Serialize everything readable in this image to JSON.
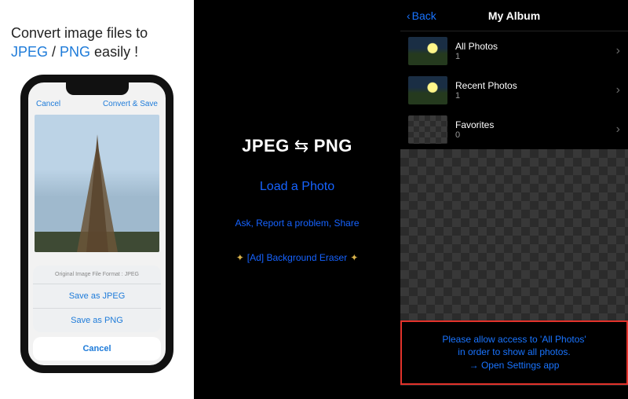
{
  "panel1": {
    "headline_pre": "Convert image files to ",
    "jpeg": "JPEG",
    "sep": " / ",
    "png": "PNG",
    "tail": " easily !",
    "phone": {
      "cancel": "Cancel",
      "convert": "Convert & Save",
      "sheet_header": "Original Image File Format : JPEG",
      "save_jpeg": "Save as JPEG",
      "save_png": "Save as PNG",
      "sheet_cancel": "Cancel"
    }
  },
  "panel2": {
    "title_l": "JPEG",
    "title_r": "PNG",
    "load": "Load a Photo",
    "ask": "Ask, Report a problem, Share",
    "ad": "[Ad] Background Eraser"
  },
  "panel3": {
    "back": "Back",
    "title": "My Album",
    "albums": [
      {
        "name": "All Photos",
        "count": "1",
        "kind": "photo"
      },
      {
        "name": "Recent Photos",
        "count": "1",
        "kind": "photo"
      },
      {
        "name": "Favorites",
        "count": "0",
        "kind": "fav"
      }
    ],
    "prompt_l1": "Please allow access to 'All Photos'",
    "prompt_l2": "in order to show all photos.",
    "prompt_l3": "→ Open Settings app"
  }
}
